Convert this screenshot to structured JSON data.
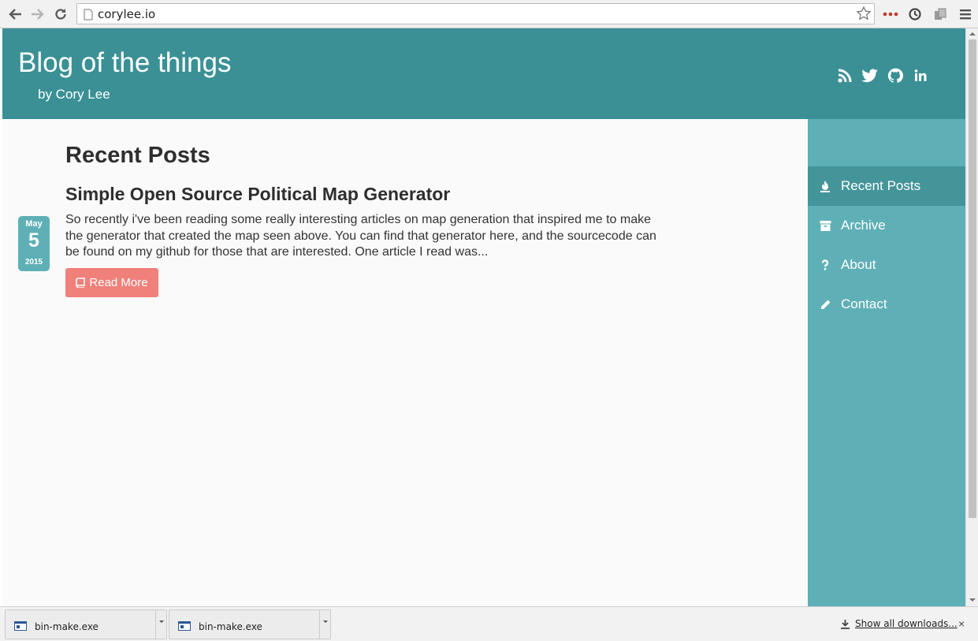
{
  "browser": {
    "url": "corylee.io",
    "icons": {
      "back": "back-arrow-icon",
      "forward": "forward-arrow-icon",
      "reload": "reload-icon",
      "star": "bookmark-star-icon",
      "menu": "menu-icon"
    }
  },
  "site": {
    "title": "Blog of the things",
    "subtitle": "by Cory Lee",
    "social": [
      "rss-icon",
      "twitter-icon",
      "github-icon",
      "linkedin-icon"
    ]
  },
  "main": {
    "heading": "Recent Posts",
    "posts": [
      {
        "date": {
          "month": "May",
          "day": "5",
          "year": "2015"
        },
        "title": "Simple Open Source Political Map Generator",
        "excerpt": "So recently i've been reading some really interesting articles on map generation that inspired me to make the generator that created the map seen above. You can find that generator here, and the sourcecode can be found on my github for those that are interested. One article I read was...",
        "read_more": "Read More"
      }
    ]
  },
  "sidebar": {
    "items": [
      {
        "label": "Recent Posts",
        "icon": "fire-icon",
        "active": true
      },
      {
        "label": "Archive",
        "icon": "archive-icon",
        "active": false
      },
      {
        "label": "About",
        "icon": "question-icon",
        "active": false
      },
      {
        "label": "Contact",
        "icon": "pencil-icon",
        "active": false
      }
    ]
  },
  "downloads": {
    "items": [
      {
        "name": "bin-make.exe"
      },
      {
        "name": "bin-make.exe"
      }
    ],
    "show_all": "Show all downloads...",
    "close": "×"
  },
  "colors": {
    "header": "#3a9095",
    "sidebar": "#5eb0b6",
    "sidebar_active": "#44959a",
    "read_more": "#f0807a"
  }
}
